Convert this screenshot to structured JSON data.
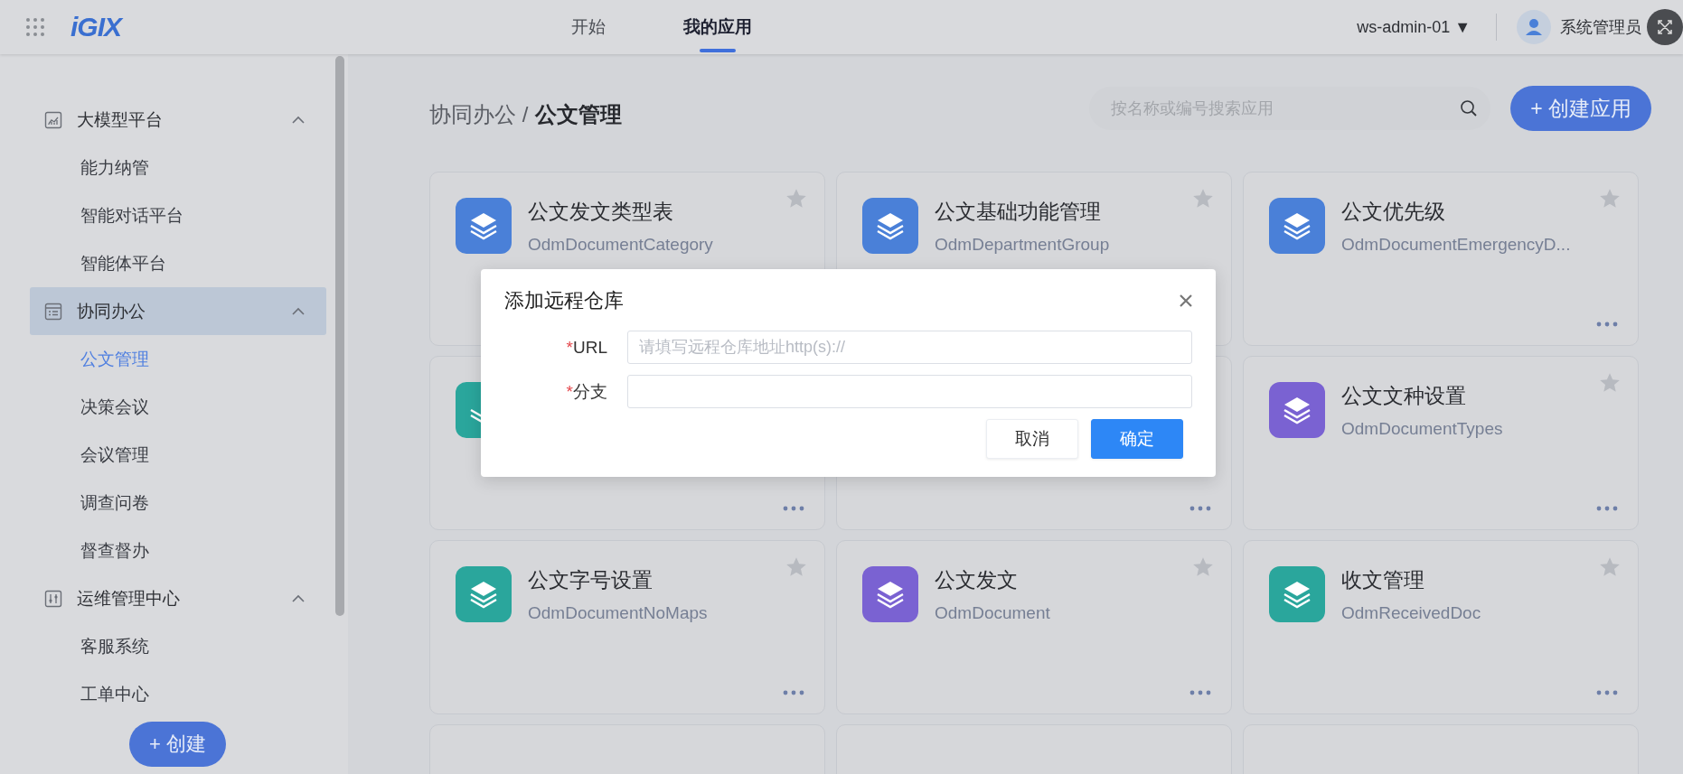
{
  "top_bar": {
    "logo": "iGIX",
    "nav": [
      {
        "label": "开始",
        "selected": false
      },
      {
        "label": "我的应用",
        "selected": true
      }
    ],
    "workspace": "ws-admin-01 ▼",
    "user": "系统管理员"
  },
  "sidebar": {
    "groups": [
      {
        "label": "大模型平台",
        "expanded": true,
        "selected": false,
        "children": [
          {
            "label": "能力纳管",
            "selected": false
          },
          {
            "label": "智能对话平台",
            "selected": false
          },
          {
            "label": "智能体平台",
            "selected": false
          }
        ]
      },
      {
        "label": "协同办公",
        "expanded": true,
        "selected": true,
        "children": [
          {
            "label": "公文管理",
            "selected": true
          },
          {
            "label": "决策会议",
            "selected": false
          },
          {
            "label": "会议管理",
            "selected": false
          },
          {
            "label": "调查问卷",
            "selected": false
          },
          {
            "label": "督查督办",
            "selected": false
          }
        ]
      },
      {
        "label": "运维管理中心",
        "expanded": true,
        "selected": false,
        "children": [
          {
            "label": "客服系统",
            "selected": false
          },
          {
            "label": "工单中心",
            "selected": false
          }
        ]
      }
    ],
    "create_button": "+ 创建"
  },
  "breadcrumb": {
    "parent": "协同办公 /",
    "current": "公文管理"
  },
  "search": {
    "placeholder": "按名称或编号搜索应用"
  },
  "create_app_button": "+ 创建应用",
  "cards": [
    {
      "kind": "app_covered",
      "title": "公文发文类型表",
      "code": "OdmDocumentCategory",
      "color": "#4a80d8",
      "starred": false
    },
    {
      "kind": "app_covered",
      "title": "公文基础功能管理",
      "code": "OdmDepartmentGroup",
      "color": "#4a80d8",
      "starred": false
    },
    {
      "kind": "app",
      "title": "公文优先级",
      "code": "OdmDocumentEmergencyD...",
      "color": "#4a80d8",
      "starred": false
    },
    {
      "kind": "covered",
      "color": "#2aa69c"
    },
    {
      "kind": "covered"
    },
    {
      "kind": "app",
      "title": "公文文种设置",
      "code": "OdmDocumentTypes",
      "color": "#7a62d2",
      "starred": false
    },
    {
      "kind": "app",
      "title": "公文字号设置",
      "code": "OdmDocumentNoMaps",
      "color": "#2aa69c",
      "starred": false
    },
    {
      "kind": "app",
      "title": "公文发文",
      "code": "OdmDocument",
      "color": "#7a62d2",
      "starred": false
    },
    {
      "kind": "app",
      "title": "收文管理",
      "code": "OdmReceivedDoc",
      "color": "#2aa69c",
      "starred": false
    },
    {
      "kind": "cut"
    },
    {
      "kind": "cut"
    },
    {
      "kind": "cut"
    }
  ],
  "dialog": {
    "title": "添加远程仓库",
    "fields": [
      {
        "label": "URL",
        "required_mark": "*",
        "placeholder": "请填写远程仓库地址http(s)://"
      },
      {
        "label": "分支",
        "required_mark": "*"
      }
    ],
    "buttons": [
      {
        "label": "取消",
        "kind": "default"
      },
      {
        "label": "确定",
        "kind": "primary"
      }
    ]
  }
}
